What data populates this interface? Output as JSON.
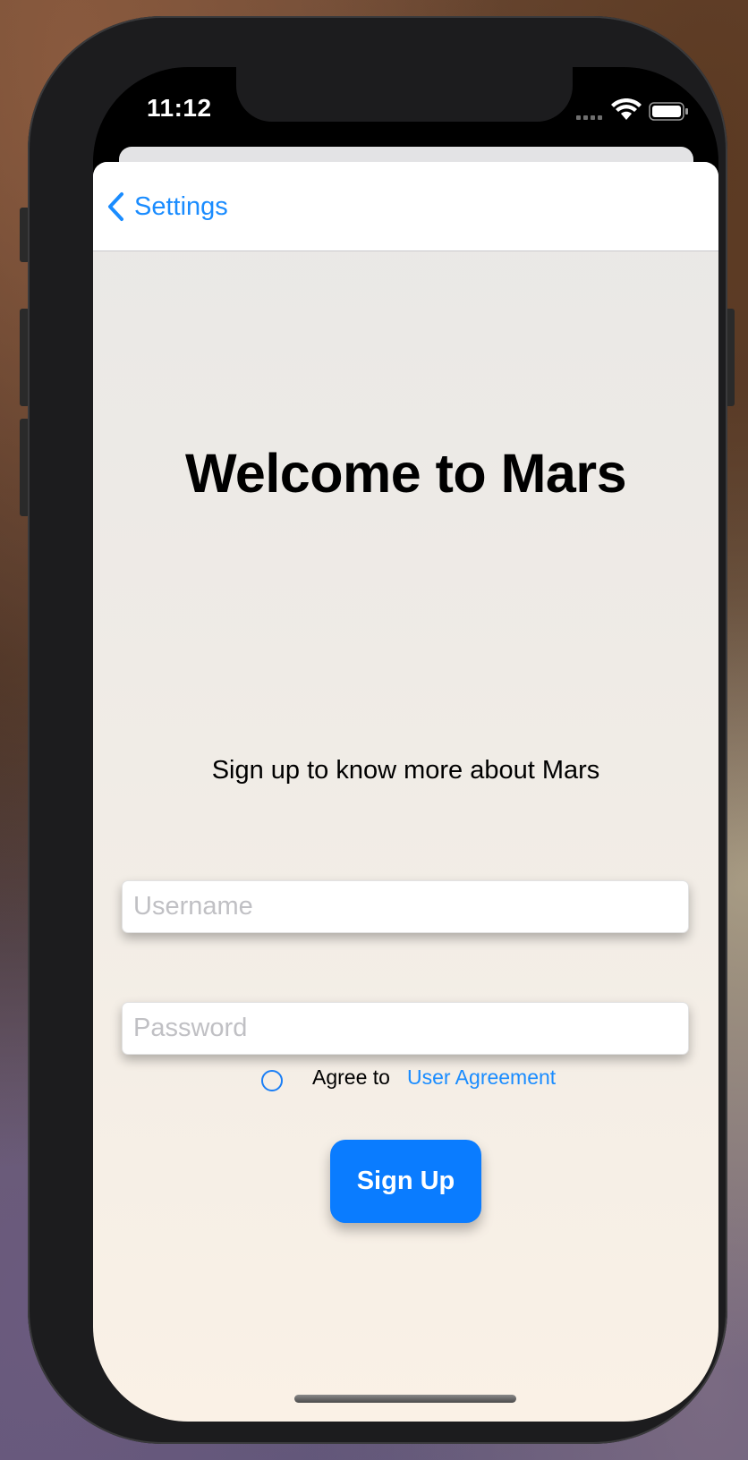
{
  "status_bar": {
    "time": "11:12"
  },
  "nav": {
    "back_label": "Settings"
  },
  "main": {
    "title": "Welcome to Mars",
    "subtitle": "Sign up to know more about Mars",
    "username_placeholder": "Username",
    "username_value": "",
    "password_placeholder": "Password",
    "password_value": "",
    "agree_text": "Agree to",
    "agreement_link": "User Agreement",
    "agree_checked": false,
    "signup_label": "Sign Up"
  },
  "icons": {
    "back": "chevron-left-icon",
    "signal": "cellular-signal-icon",
    "wifi": "wifi-icon",
    "battery": "battery-icon",
    "radio": "radio-circle-icon"
  },
  "colors": {
    "accent": "#0a7cff",
    "link": "#1a8cff"
  }
}
